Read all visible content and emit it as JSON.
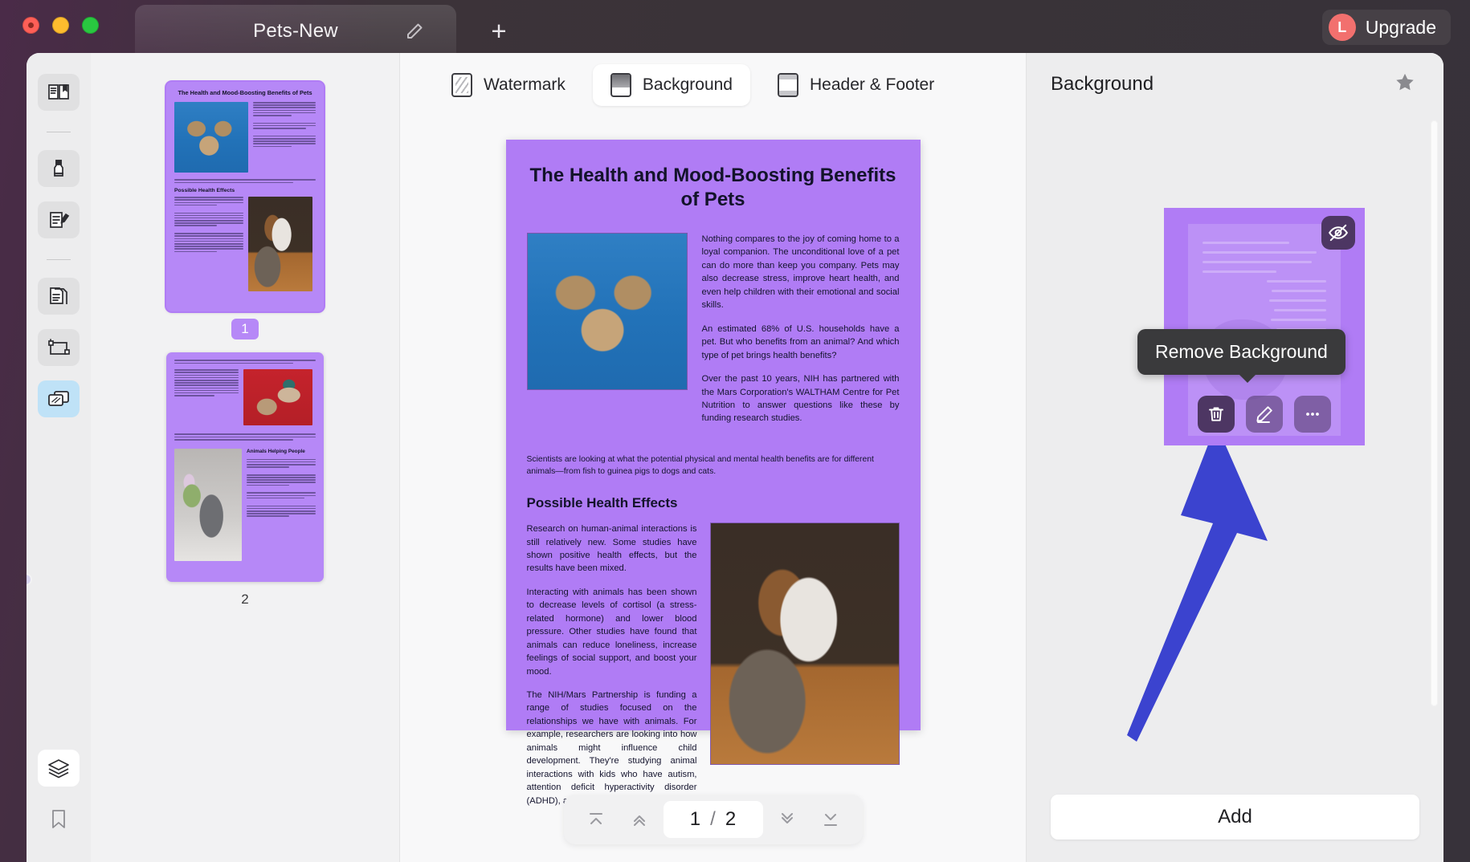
{
  "window": {
    "tab_title": "Pets-New",
    "new_tab_label": "+",
    "upgrade": {
      "avatar_initial": "L",
      "label": "Upgrade"
    },
    "traffic_lights": [
      "close",
      "minimize",
      "zoom"
    ]
  },
  "rail": {
    "items": [
      {
        "name": "reader-view",
        "icon": "book-icon"
      },
      {
        "name": "highlight",
        "icon": "marker-icon"
      },
      {
        "name": "annotate",
        "icon": "edit-document-icon"
      },
      {
        "name": "organize-pages",
        "icon": "pages-icon"
      },
      {
        "name": "crop",
        "icon": "crop-icon"
      },
      {
        "name": "background",
        "icon": "layers-cards-icon"
      },
      {
        "name": "layers",
        "icon": "stack-icon"
      },
      {
        "name": "bookmark",
        "icon": "bookmark-icon"
      }
    ]
  },
  "thumbnails": {
    "pages": [
      {
        "number": "1",
        "selected": true
      },
      {
        "number": "2",
        "selected": false
      }
    ]
  },
  "toolbar": {
    "tabs": [
      {
        "label": "Watermark",
        "icon": "watermark-icon",
        "active": false
      },
      {
        "label": "Background",
        "icon": "background-icon",
        "active": true
      },
      {
        "label": "Header & Footer",
        "icon": "header-footer-icon",
        "active": false
      }
    ]
  },
  "document": {
    "title": "The Health and Mood-Boosting Benefits of Pets",
    "paragraph_1": "Nothing compares to the joy of coming home to a loyal companion. The unconditional love of a pet can do more than keep you company. Pets may also decrease stress, improve heart health, and even help children with their emotional and social skills.",
    "paragraph_2": "An estimated 68% of U.S. households have a pet. But who benefits from an animal? And which type of pet brings health benefits?",
    "paragraph_3": "Over the past 10 years, NIH has partnered with the Mars Corporation's WALTHAM Centre for Pet Nutrition to answer questions like these by funding research studies.",
    "wide_note": "Scientists are looking at what the potential physical and mental health benefits are for different animals—from fish to guinea pigs to dogs and cats.",
    "heading_2": "Possible Health Effects",
    "paragraph_4": "Research on human-animal interactions is still relatively new. Some studies have shown positive health effects, but the results have been mixed.",
    "paragraph_5": "Interacting with animals has been shown to decrease levels of cortisol (a stress-related hormone) and lower blood pressure. Other studies have found that animals can reduce loneliness, increase feelings of social support, and boost your mood.",
    "paragraph_6": "The NIH/Mars Partnership is funding a range of studies focused on the relationships we have with animals. For example, researchers are looking into how animals might influence child development. They're studying animal interactions with kids who have autism, attention deficit hyperactivity disorder (ADHD), and other conditions.",
    "image_1_alt": "tabby cat against blue sky",
    "image_2_alt": "dog and cat resting together"
  },
  "pager": {
    "first_label": "first-page",
    "prev_label": "previous-page",
    "current": "1",
    "separator": "/",
    "total": "2",
    "next_label": "next-page",
    "last_label": "last-page"
  },
  "right_panel": {
    "title": "Background",
    "favorite_icon": "star-icon",
    "card": {
      "visibility_icon": "eye-off-icon",
      "actions": [
        {
          "name": "remove-background",
          "icon": "trash-icon",
          "primary": true
        },
        {
          "name": "edit-background",
          "icon": "pencil-icon",
          "primary": false
        },
        {
          "name": "more-options",
          "icon": "ellipsis-icon",
          "primary": false
        }
      ]
    },
    "tooltip": "Remove Background",
    "add_label": "Add"
  },
  "colors": {
    "accent_purple": "#b07cf5",
    "arrow_blue": "#3b43cf",
    "tooltip_bg": "#3a3a3c",
    "upgrade_avatar": "#f2706e",
    "active_rail": "#bfe2f7"
  }
}
